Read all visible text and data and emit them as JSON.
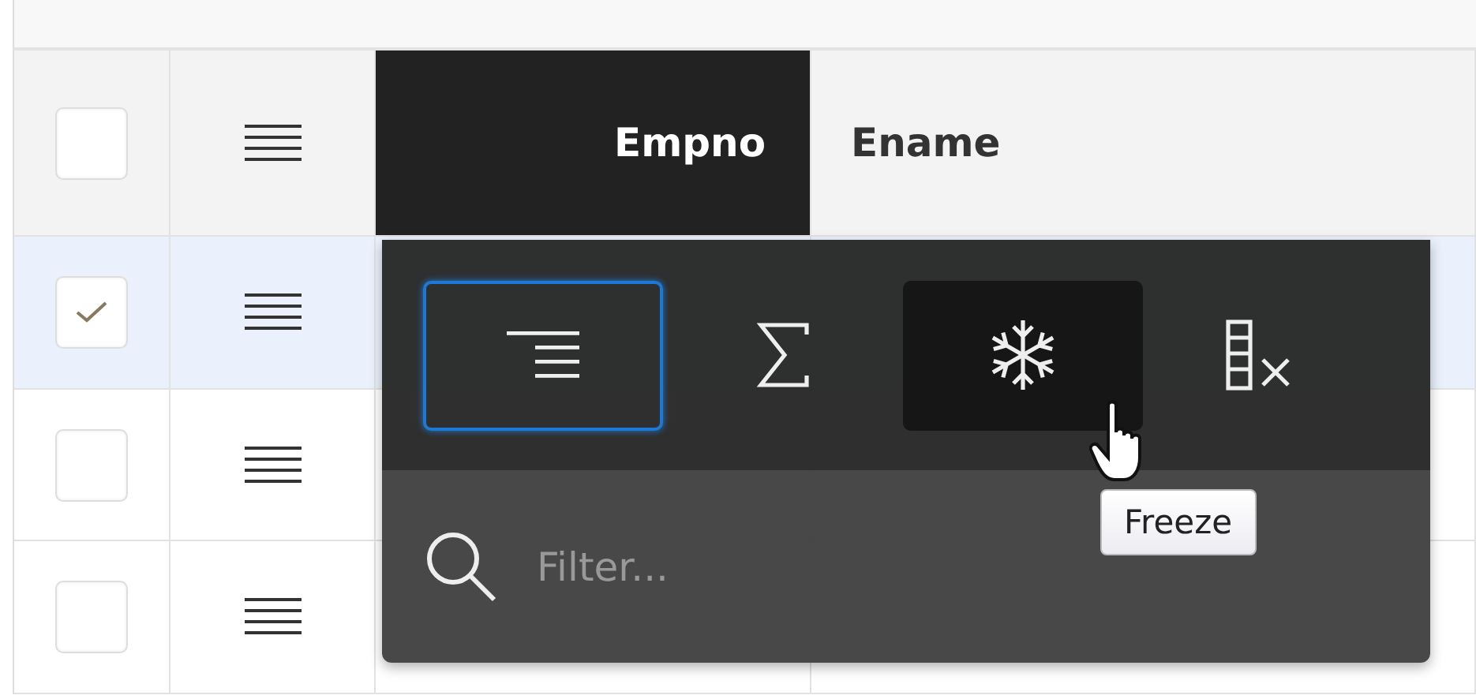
{
  "table": {
    "columns": [
      {
        "label": "Empno",
        "selected": true
      },
      {
        "label": "Ename",
        "selected": false
      }
    ],
    "header_checkbox": {
      "checked": false
    },
    "rows": [
      {
        "checked": true,
        "selected": true
      },
      {
        "checked": false,
        "selected": false
      },
      {
        "checked": false,
        "selected": false
      }
    ]
  },
  "column_menu": {
    "actions": [
      {
        "kind": "sort",
        "selected": true,
        "hovered": false
      },
      {
        "kind": "aggregate",
        "selected": false,
        "hovered": false
      },
      {
        "kind": "freeze",
        "selected": false,
        "hovered": true
      },
      {
        "kind": "hide",
        "selected": false,
        "hovered": false
      }
    ],
    "filter": {
      "placeholder": "Filter..."
    },
    "tooltip": "Freeze"
  }
}
